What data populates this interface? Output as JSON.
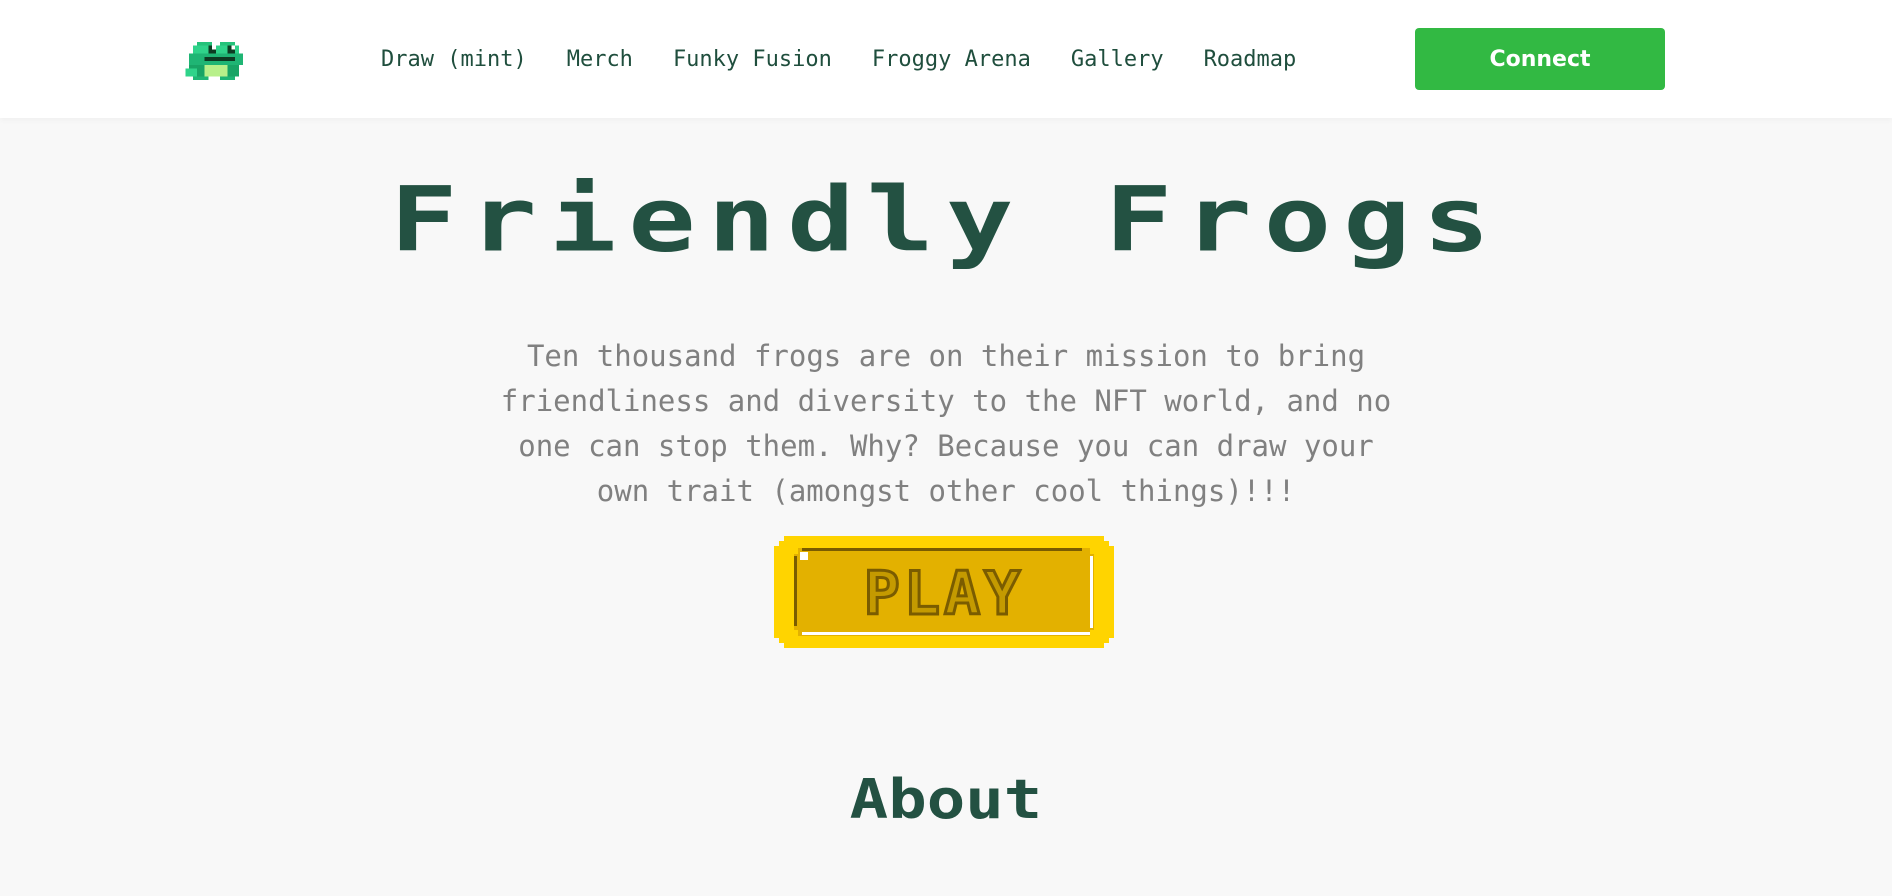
{
  "header": {
    "logo_icon": "frog-logo-icon",
    "nav": [
      {
        "label": "Draw (mint)"
      },
      {
        "label": "Merch"
      },
      {
        "label": "Funky Fusion"
      },
      {
        "label": "Froggy Arena"
      },
      {
        "label": "Gallery"
      },
      {
        "label": "Roadmap"
      }
    ],
    "connect_label": "Connect",
    "connect_color": "#32b943"
  },
  "hero": {
    "title": "Friendly Frogs",
    "description": "Ten thousand frogs are on their mission to bring friendliness and diversity to the NFT world, and no one can stop them. Why? Because you can draw your own trait (amongst other cool things)!!!",
    "play_label": "PLAY",
    "title_color": "#235142",
    "play_colors": {
      "outer": "#ffd400",
      "inner": "#e3b100",
      "text": "#c49a00"
    }
  },
  "about": {
    "title": "About"
  }
}
